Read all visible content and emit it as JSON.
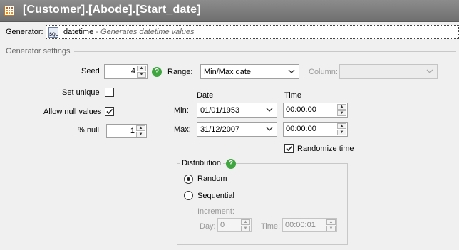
{
  "window": {
    "title": "[Customer].[Abode].[Start_date]",
    "title_icon": "table-grid-icon"
  },
  "generator": {
    "label": "Generator:",
    "icon": "sql-icon",
    "icon_text": "SQL",
    "name": "datetime",
    "description": "- Generates datetime values"
  },
  "settings": {
    "group_label": "Generator settings",
    "seed_label": "Seed",
    "seed_value": "4",
    "set_unique_label": "Set unique",
    "set_unique_checked": false,
    "allow_null_label": "Allow null values",
    "allow_null_checked": true,
    "percent_null_label": "% null",
    "percent_null_value": "1"
  },
  "range": {
    "label": "Range:",
    "value": "Min/Max date",
    "column_label": "Column:",
    "column_value": "",
    "date_header": "Date",
    "time_header": "Time",
    "min_label": "Min:",
    "min_date": "01/01/1953",
    "min_time": "00:00:00",
    "max_label": "Max:",
    "max_date": "31/12/2007",
    "max_time": "00:00:00",
    "randomize_time_label": "Randomize time",
    "randomize_time_checked": true
  },
  "distribution": {
    "label": "Distribution",
    "options": [
      "Random",
      "Sequential"
    ],
    "selected": "Random",
    "increment_label": "Increment:",
    "day_label": "Day:",
    "day_value": "0",
    "time_label": "Time:",
    "time_value": "00:00:01"
  },
  "colors": {
    "title_bar": "#7d7d7d",
    "help_icon": "#3fa63f",
    "background": "#f0f0f0"
  }
}
